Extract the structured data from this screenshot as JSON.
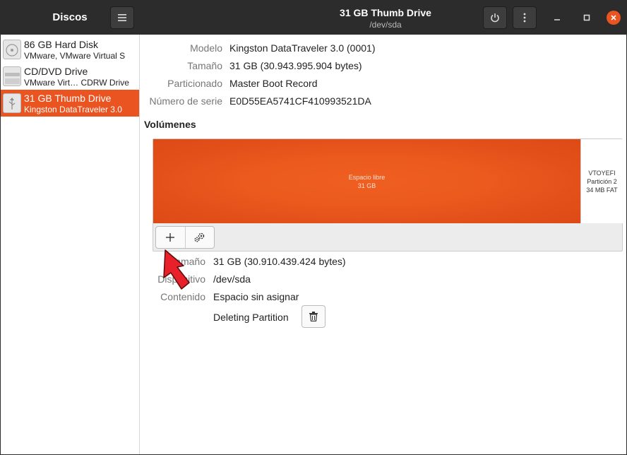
{
  "titlebar": {
    "app_title": "Discos",
    "disk_title": "31 GB Thumb Drive",
    "disk_path": "/dev/sda"
  },
  "sidebar": {
    "disks": [
      {
        "name": "86 GB Hard Disk",
        "model": "VMware, VMware Virtual S",
        "icon": "hard-disk-icon"
      },
      {
        "name": "CD/DVD Drive",
        "model": "VMware Virt… CDRW Drive",
        "icon": "optical-drive-icon"
      },
      {
        "name": "31 GB Thumb Drive",
        "model": "Kingston DataTraveler 3.0",
        "icon": "usb-drive-icon",
        "selected": true
      }
    ]
  },
  "drive_info": {
    "modelo_label": "Modelo",
    "modelo_value": "Kingston DataTraveler 3.0 (0001)",
    "tamano_label": "Tamaño",
    "tamano_value": "31 GB (30.943.995.904 bytes)",
    "particionado_label": "Particionado",
    "particionado_value": "Master Boot Record",
    "serie_label": "Número de serie",
    "serie_value": "E0D55EA5741CF410993521DA"
  },
  "volumes": {
    "title": "Volúmenes",
    "free_label": "Espacio libre",
    "free_size": "31 GB",
    "part2_name": "VTOYEFI",
    "part2_label": "Partición 2",
    "part2_size": "34 MB FAT"
  },
  "volume_info": {
    "tamano_label": "Tamaño",
    "tamano_value": "31 GB (30.910.439.424 bytes)",
    "dispositivo_label": "Dispositivo",
    "dispositivo_value": "/dev/sda",
    "contenido_label": "Contenido",
    "contenido_value": "Espacio sin asignar",
    "status_text": "Deleting Partition"
  },
  "colors": {
    "accent": "#e95420",
    "titlebar": "#2c2c2c"
  }
}
